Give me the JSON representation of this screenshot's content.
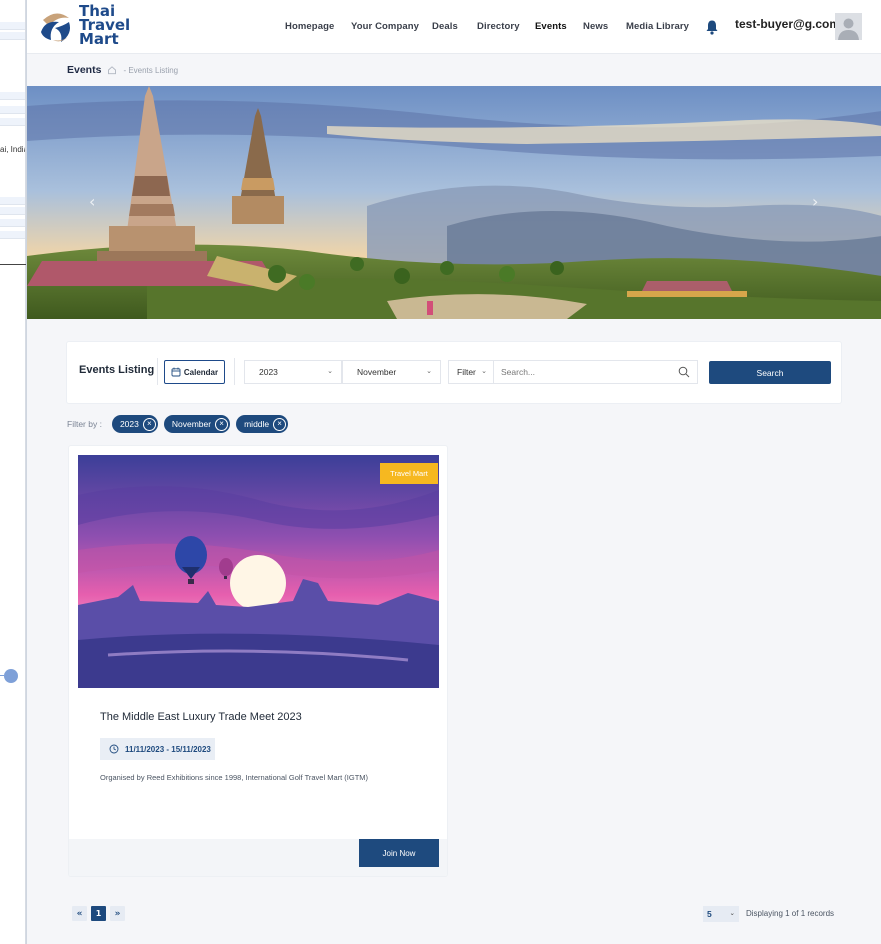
{
  "background_app": {
    "fragment_text": "ai, India"
  },
  "brand": {
    "line1": "Thai",
    "line2": "Travel",
    "line3": "Mart"
  },
  "nav": {
    "items": [
      {
        "label": "Homepage"
      },
      {
        "label": "Your Company"
      },
      {
        "label": "Deals"
      },
      {
        "label": "Directory"
      },
      {
        "label": "Events",
        "active": true
      },
      {
        "label": "News"
      },
      {
        "label": "Media Library"
      }
    ],
    "user_email": "test-buyer@g.com"
  },
  "breadcrumb": {
    "title": "Events",
    "separator_and_current": "- Events Listing"
  },
  "hero": {
    "prev_arrow": "‹",
    "next_arrow": "›"
  },
  "filter_bar": {
    "title": "Events Listing",
    "calendar_label": "Calendar",
    "year_value": "2023",
    "month_value": "November",
    "filter_label": "Filter",
    "search_placeholder": "Search...",
    "search_button": "Search"
  },
  "active_filters": {
    "label": "Filter by :",
    "chips": [
      {
        "label": "2023"
      },
      {
        "label": "November"
      },
      {
        "label": "middle"
      }
    ]
  },
  "events": [
    {
      "badge": "Travel Mart",
      "title": "The Middle East Luxury Trade Meet 2023",
      "dates": "11/11/2023 - 15/11/2023",
      "description": "Organised by Reed Exhibitions since 1998, International Golf Travel Mart (IGTM)",
      "cta": "Join Now"
    }
  ],
  "pagination": {
    "first": "«",
    "current_page": "1",
    "next": "»",
    "per_page": "5",
    "status": "Displaying 1 of 1 records"
  },
  "colors": {
    "primary": "#1e4a7e",
    "badge": "#f6b820",
    "page_bg": "#f5f6f9"
  }
}
